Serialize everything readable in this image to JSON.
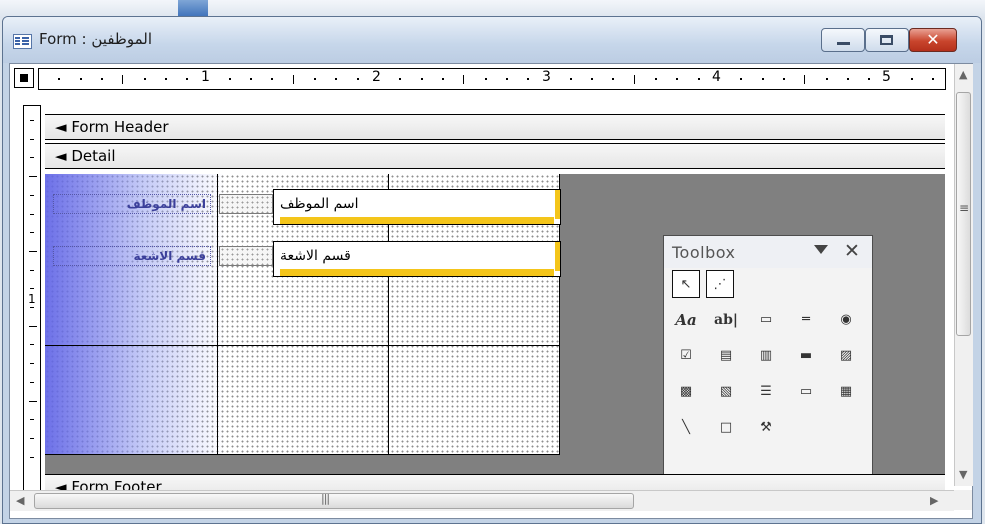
{
  "window": {
    "title": "Form : الموظفين",
    "controls": {
      "minimize": "minimize",
      "maximize": "maximize",
      "close": "✕"
    }
  },
  "ruler": {
    "numbers": [
      "1",
      "2",
      "3",
      "4",
      "5"
    ],
    "vertical_number": "1"
  },
  "sections": {
    "header": "Form Header",
    "detail": "Detail",
    "footer": "Form Footer"
  },
  "fields": [
    {
      "label": "اسم الموظف",
      "textbox": "اسم الموظف"
    },
    {
      "label": "قسم الاشعة",
      "textbox": "قسم الاشعة"
    }
  ],
  "toolbox": {
    "title": "Toolbox",
    "tools": [
      {
        "name": "select-objects",
        "glyph": "↖"
      },
      {
        "name": "control-wizards",
        "glyph": "⋰"
      },
      {
        "name": "label",
        "glyph": "Aa"
      },
      {
        "name": "text-box",
        "glyph": "ab|"
      },
      {
        "name": "option-group",
        "glyph": "▭"
      },
      {
        "name": "toggle-button",
        "glyph": "═"
      },
      {
        "name": "option-button",
        "glyph": "◉"
      },
      {
        "name": "check-box",
        "glyph": "☑"
      },
      {
        "name": "combo-box",
        "glyph": "▤"
      },
      {
        "name": "list-box",
        "glyph": "▥"
      },
      {
        "name": "command-button",
        "glyph": "▬"
      },
      {
        "name": "image",
        "glyph": "▨"
      },
      {
        "name": "unbound-object-frame",
        "glyph": "▩"
      },
      {
        "name": "bound-object-frame",
        "glyph": "▧"
      },
      {
        "name": "page-break",
        "glyph": "☰"
      },
      {
        "name": "tab-control",
        "glyph": "▭"
      },
      {
        "name": "subform",
        "glyph": "▦"
      },
      {
        "name": "line",
        "glyph": "╲"
      },
      {
        "name": "rectangle",
        "glyph": "□"
      },
      {
        "name": "more-controls",
        "glyph": "⚒"
      }
    ]
  },
  "colors": {
    "accent_yellow": "#f4c51a",
    "detail_background": "#808080",
    "close_red": "#c9452d",
    "label_text": "#3b3f9a"
  }
}
